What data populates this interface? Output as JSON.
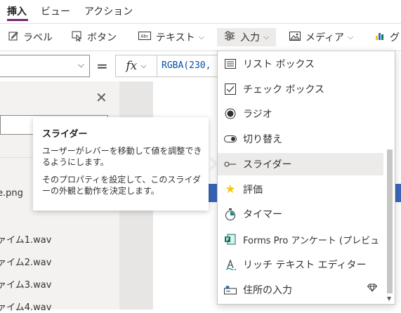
{
  "tabs": [
    {
      "label": "挿入",
      "active": true
    },
    {
      "label": "ビュー",
      "active": false
    },
    {
      "label": "アクション",
      "active": false
    }
  ],
  "ribbon": {
    "label_btn": "ラベル",
    "button_btn": "ボタン",
    "text_btn": "テキスト",
    "input_btn": "入力",
    "media_btn": "メディア",
    "chart_btn": "グ"
  },
  "formula": {
    "value": "RGBA(230,"
  },
  "left_panel": {
    "files": [
      "e.png",
      "ァイム1.wav",
      "ァイム2.wav",
      "ァイム3.wav",
      "ァイム4.wav"
    ]
  },
  "tooltip": {
    "title": "スライダー",
    "p1": "ユーザーがレバーを移動して値を調整できるようにします。",
    "p2": "そのプロパティを設定して、このスライダーの外観と動作を決定します。"
  },
  "menu": {
    "items": [
      {
        "label": "リスト ボックス",
        "icon": "list-box-icon"
      },
      {
        "label": "チェック ボックス",
        "icon": "checkbox-icon"
      },
      {
        "label": "ラジオ",
        "icon": "radio-icon"
      },
      {
        "label": "切り替え",
        "icon": "toggle-icon"
      },
      {
        "label": "スライダー",
        "icon": "slider-icon"
      },
      {
        "label": "評価",
        "icon": "star-icon"
      },
      {
        "label": "タイマー",
        "icon": "timer-icon"
      },
      {
        "label": "Forms Pro アンケート (プレビュ",
        "icon": "forms-pro-icon"
      },
      {
        "label": "リッチ テキスト エディター",
        "icon": "rich-text-icon"
      },
      {
        "label": "住所の入力",
        "icon": "address-input-icon"
      }
    ],
    "hovered_index": 4
  },
  "colors": {
    "accent": "#742774",
    "star": "#f2c811",
    "forms_green": "#077568",
    "timer_teal": "#0f8b8d",
    "blue_bar": "#3a67b8"
  }
}
